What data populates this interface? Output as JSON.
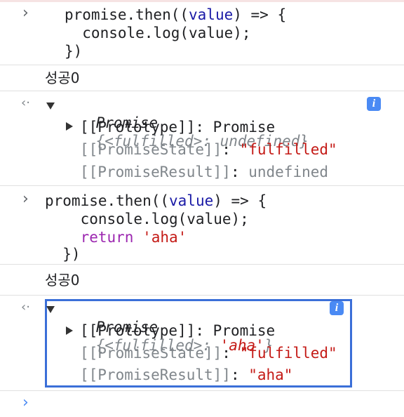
{
  "console": {
    "input_prompt": "›",
    "output_prompt": "‹·",
    "entries": [
      {
        "type": "input",
        "lines": [
          "promise.then((value) => {",
          "  console.log(value);",
          "})"
        ]
      },
      {
        "type": "log",
        "text": "성공0"
      },
      {
        "type": "result",
        "summary": {
          "name": "Promise",
          "open": "{",
          "key": "<fulfilled>",
          "sep": ": ",
          "value": "undefined",
          "close": "}"
        },
        "props": [
          {
            "key": "[[Prototype]]",
            "sep": ": ",
            "value": "Promise"
          },
          {
            "key": "[[PromiseState]]",
            "sep": ": ",
            "value": "\"fulfilled\""
          },
          {
            "key": "[[PromiseResult]]",
            "sep": ": ",
            "value": "undefined"
          }
        ],
        "info_label": "i"
      },
      {
        "type": "input",
        "lines": [
          "promise.then((value) => {",
          "    console.log(value);",
          "    return 'aha'",
          "  })"
        ]
      },
      {
        "type": "log",
        "text": "성공0"
      },
      {
        "type": "result",
        "summary": {
          "name": "Promise",
          "open": "{",
          "key": "<fulfilled>",
          "sep": ": ",
          "value": "'aha'",
          "close": "}"
        },
        "props": [
          {
            "key": "[[Prototype]]",
            "sep": ": ",
            "value": "Promise"
          },
          {
            "key": "[[PromiseState]]",
            "sep": ": ",
            "value": "\"fulfilled\""
          },
          {
            "key": "[[PromiseResult]]",
            "sep": ": ",
            "value": "\"aha\""
          }
        ],
        "info_label": "i"
      }
    ],
    "empty_prompt": "›"
  },
  "colors": {
    "keyword": "#9c27b0",
    "string": "#c41a16",
    "param": "#1a1aa6",
    "highlight_border": "#3b6fd8"
  }
}
